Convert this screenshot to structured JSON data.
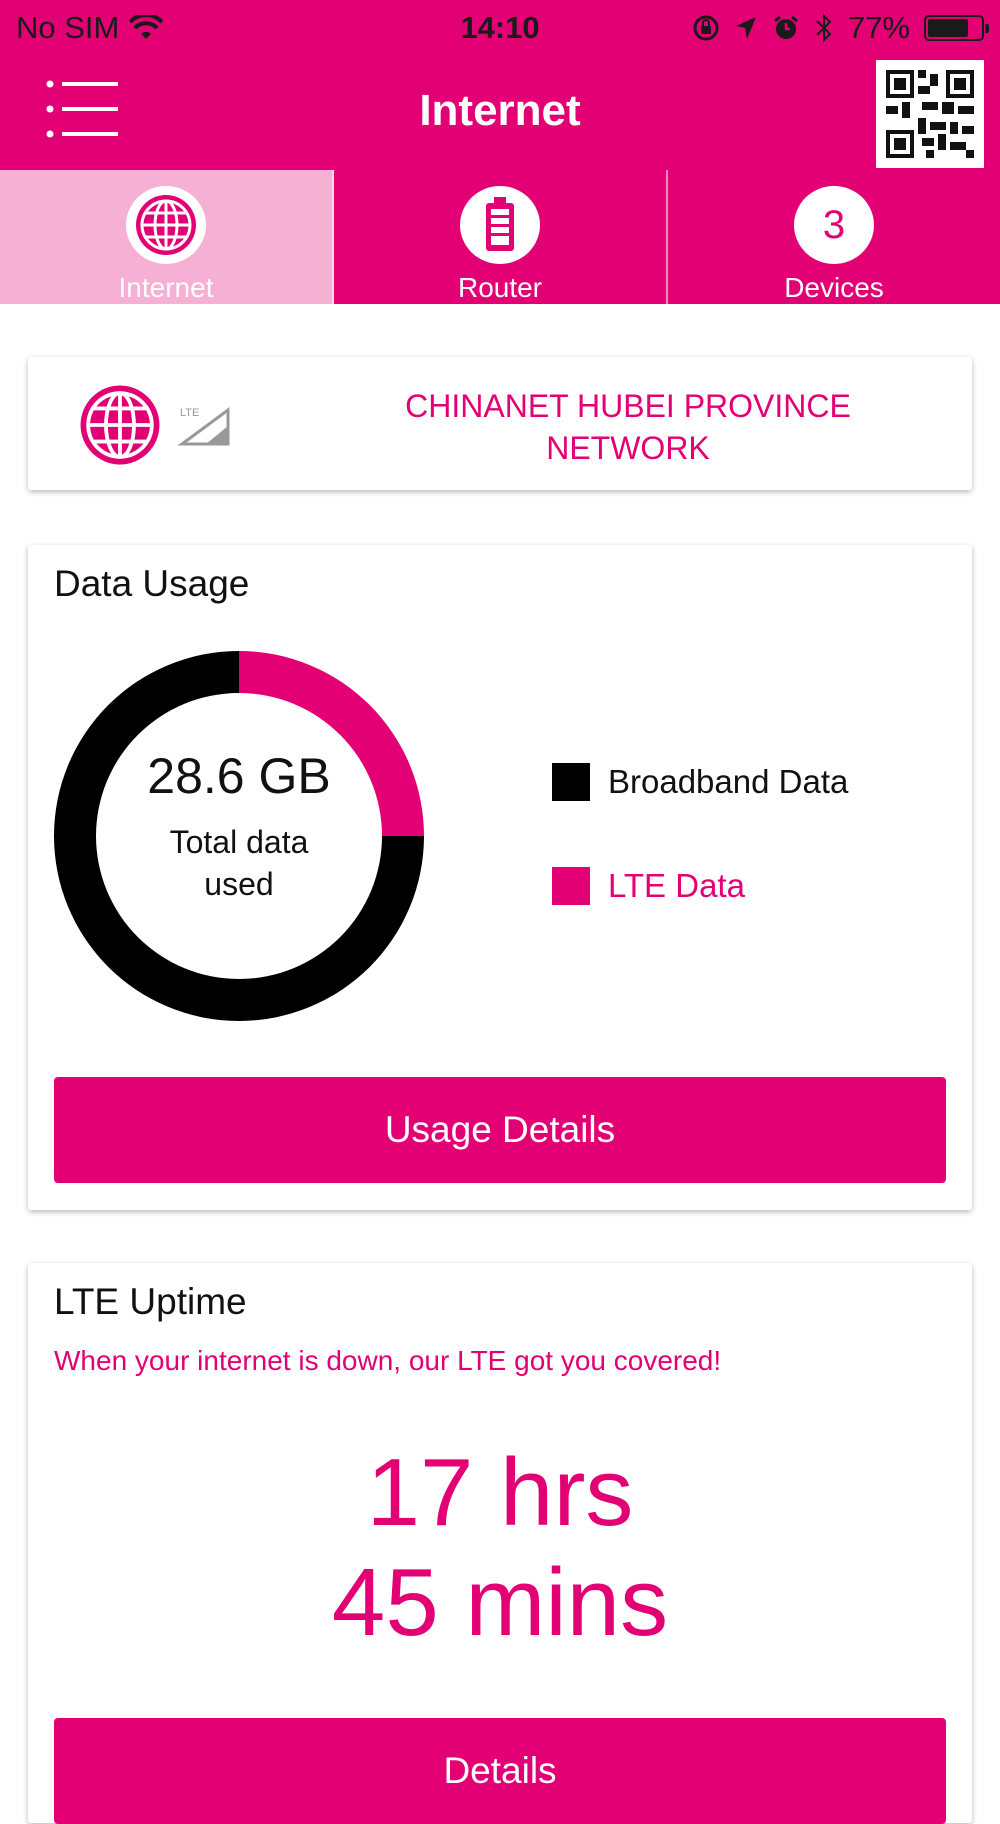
{
  "status_bar": {
    "carrier": "No SIM",
    "time": "14:10",
    "battery": "77%",
    "battery_level": 0.77,
    "icons": [
      "wifi-icon",
      "orientation-lock-icon",
      "location-icon",
      "alarm-icon",
      "bluetooth-icon",
      "battery-icon"
    ]
  },
  "nav": {
    "title": "Internet",
    "menu_icon": "menu-icon",
    "qr_icon": "qr-code-icon"
  },
  "tabs": [
    {
      "label": "Internet",
      "icon": "globe-icon",
      "active": true
    },
    {
      "label": "Router",
      "icon": "battery-router-icon",
      "active": false
    },
    {
      "label": "Devices",
      "count": "3",
      "active": false
    }
  ],
  "network": {
    "name_line1": "CHINANET HUBEI PROVINCE",
    "name_line2": "NETWORK",
    "badge": "LTE"
  },
  "usage": {
    "title": "Data Usage",
    "total_value": "28.6 GB",
    "total_caption": "Total data used",
    "button_label": "Usage Details",
    "chart_data": {
      "type": "pie",
      "series": [
        {
          "name": "Broadband Data",
          "value": 0.75,
          "color": "#000000"
        },
        {
          "name": "LTE Data",
          "value": 0.25,
          "color": "#e20074"
        }
      ]
    },
    "legend": [
      {
        "label": "Broadband Data",
        "color": "#000000",
        "text_color": "#111111"
      },
      {
        "label": "LTE Data",
        "color": "#e20074",
        "text_color": "#e20074"
      }
    ]
  },
  "uptime": {
    "title": "LTE Uptime",
    "subtitle": "When your internet is down, our LTE got you covered!",
    "hours": "17 hrs",
    "minutes": "45 mins",
    "button_label": "Details"
  },
  "colors": {
    "brand": "#e20074",
    "tab_active": "#f5b0d3"
  }
}
